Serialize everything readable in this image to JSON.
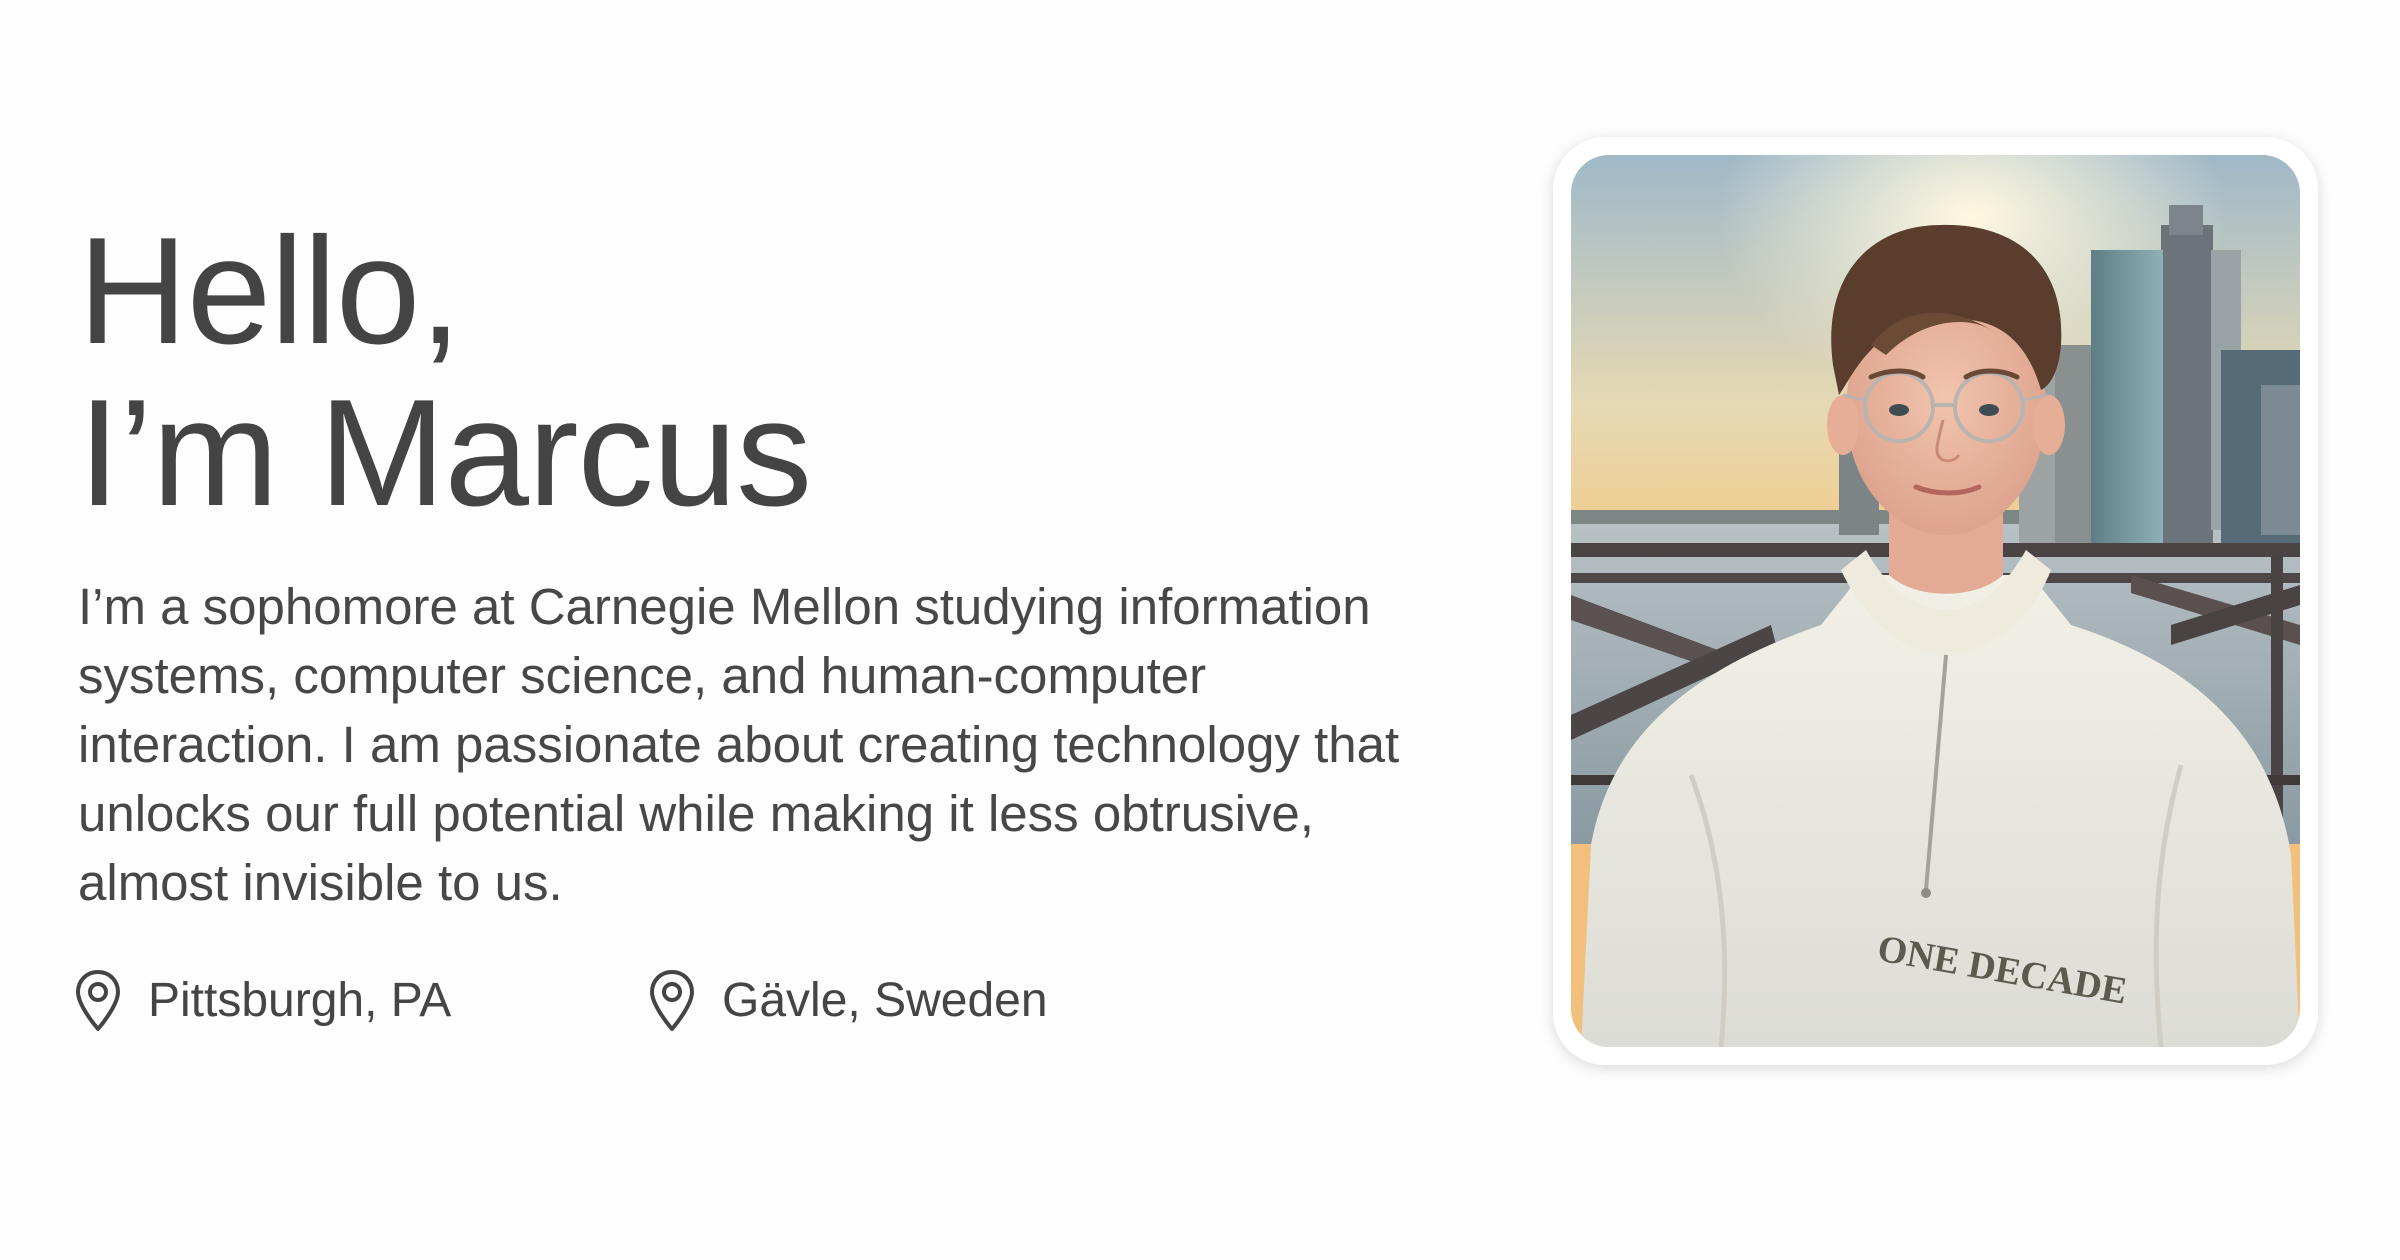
{
  "hero": {
    "greeting_line1": "Hello,",
    "greeting_line2": "I’m Marcus",
    "bio": "I’m a sophomore at Carnegie Mellon studying information systems, computer science, and human-computer interaction. I am passionate about creating technology that unlocks our full potential while making it less obtrusive, almost invisible to us."
  },
  "locations": [
    {
      "icon": "map-pin-icon",
      "label": "Pittsburgh, PA"
    },
    {
      "icon": "map-pin-icon",
      "label": "Gävle, Sweden"
    }
  ],
  "photo": {
    "sweatshirt_text": "ONE DECADE"
  },
  "colors": {
    "background": "#fdfdfd",
    "text": "#444444",
    "frame": "#ffffff"
  }
}
